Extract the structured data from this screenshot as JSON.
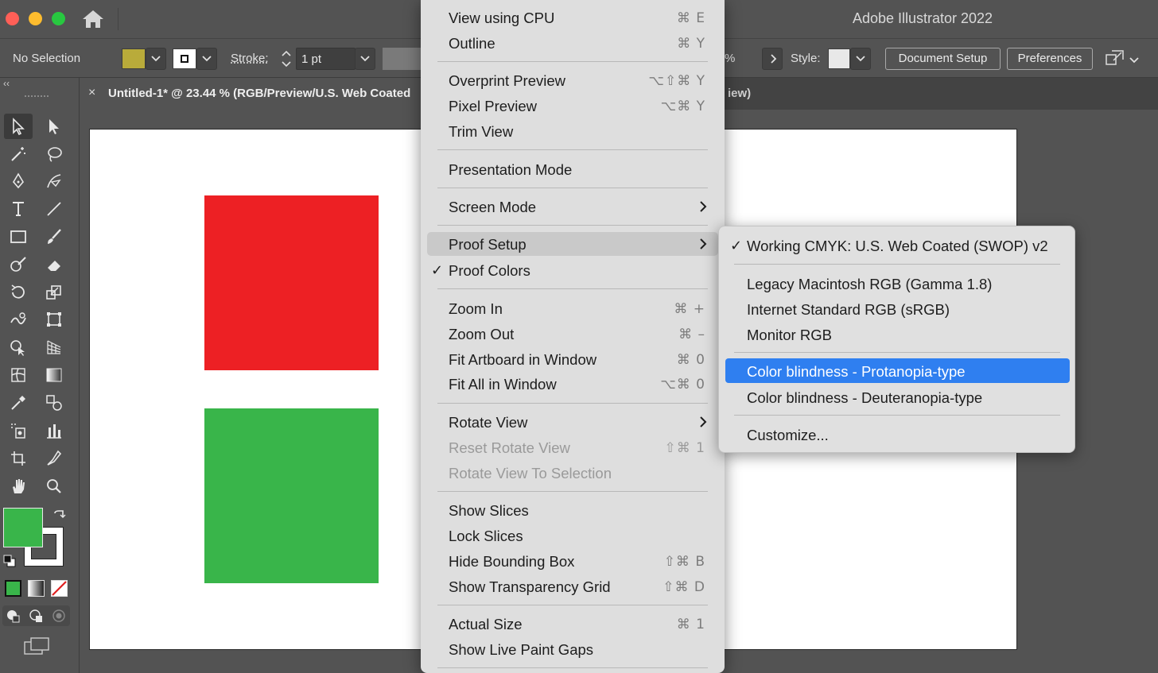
{
  "app_title": "Adobe Illustrator 2022",
  "control_bar": {
    "selection_label": "No Selection",
    "fill_color": "#b9ab3a",
    "stroke_label": "Stroke:",
    "stroke_value": "1 pt",
    "percent_fragment": "%",
    "style_label": "Style:",
    "document_setup": "Document Setup",
    "preferences": "Preferences"
  },
  "document_tab": {
    "close": "×",
    "title": "Untitled-1* @ 23.44 % (RGB/Preview/U.S. Web Coated",
    "title_tail": "iew)"
  },
  "toolbar": {
    "collapse": "‹‹",
    "fill_color": "#39b54a",
    "tools": [
      "selection-tool",
      "direct-selection-tool",
      "magic-wand-tool",
      "lasso-tool",
      "pen-tool",
      "curvature-tool",
      "type-tool",
      "line-segment-tool",
      "rectangle-tool",
      "paintbrush-tool",
      "shaper-tool",
      "eraser-tool",
      "rotate-tool",
      "scale-tool",
      "warp-tool",
      "free-transform-tool",
      "shape-builder-tool",
      "perspective-grid-tool",
      "mesh-tool",
      "gradient-tool",
      "eyedropper-tool",
      "blend-tool",
      "symbol-sprayer-tool",
      "column-graph-tool",
      "artboard-tool",
      "slice-tool",
      "hand-tool",
      "zoom-tool"
    ]
  },
  "artboard": {
    "shape1_color": "#ed2024",
    "shape2_color": "#39b54a"
  },
  "view_menu": {
    "items": [
      {
        "label": "View using CPU",
        "shortcut": "⌘ E"
      },
      {
        "label": "Outline",
        "shortcut": "⌘ Y"
      },
      {
        "label": "Overprint Preview",
        "shortcut": "⌥⇧⌘ Y"
      },
      {
        "label": "Pixel Preview",
        "shortcut": "⌥⌘ Y"
      },
      {
        "label": "Trim View",
        "shortcut": ""
      },
      {
        "label": "Presentation Mode",
        "shortcut": ""
      },
      {
        "label": "Screen Mode",
        "shortcut": ""
      },
      {
        "label": "Proof Setup",
        "shortcut": ""
      },
      {
        "label": "Proof Colors",
        "shortcut": "",
        "checked": "✓"
      },
      {
        "label": "Zoom In",
        "shortcut": "⌘ +"
      },
      {
        "label": "Zoom Out",
        "shortcut": "⌘ –"
      },
      {
        "label": "Fit Artboard in Window",
        "shortcut": "⌘ 0"
      },
      {
        "label": "Fit All in Window",
        "shortcut": "⌥⌘ 0"
      },
      {
        "label": "Rotate View",
        "shortcut": ""
      },
      {
        "label": "Reset Rotate View",
        "shortcut": "⇧⌘ 1"
      },
      {
        "label": "Rotate View To Selection",
        "shortcut": ""
      },
      {
        "label": "Show Slices",
        "shortcut": ""
      },
      {
        "label": "Lock Slices",
        "shortcut": ""
      },
      {
        "label": "Hide Bounding Box",
        "shortcut": "⇧⌘ B"
      },
      {
        "label": "Show Transparency Grid",
        "shortcut": "⇧⌘ D"
      },
      {
        "label": "Actual Size",
        "shortcut": "⌘ 1"
      },
      {
        "label": "Show Live Paint Gaps",
        "shortcut": ""
      }
    ]
  },
  "proof_setup_submenu": {
    "items": [
      {
        "label": "Working CMYK: U.S. Web Coated (SWOP) v2",
        "checked": "✓"
      },
      {
        "label": "Legacy Macintosh RGB (Gamma 1.8)"
      },
      {
        "label": "Internet Standard RGB (sRGB)"
      },
      {
        "label": "Monitor RGB"
      },
      {
        "label": "Color blindness - Protanopia-type"
      },
      {
        "label": "Color blindness - Deuteranopia-type"
      },
      {
        "label": "Customize..."
      }
    ]
  }
}
